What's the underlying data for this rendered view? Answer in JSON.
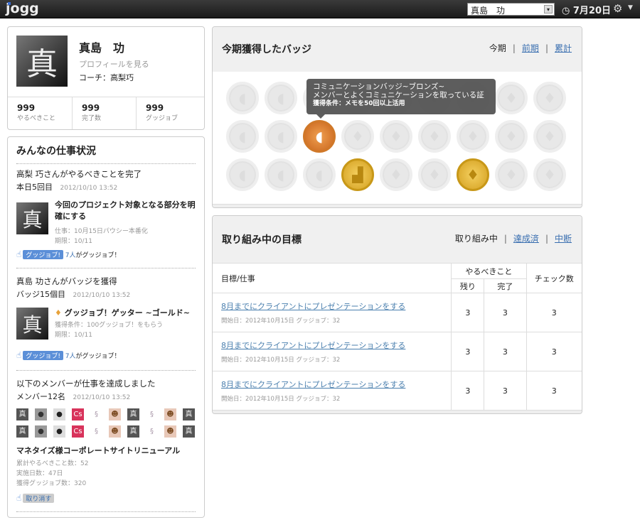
{
  "topbar": {
    "logo": "jogg",
    "user_select": "真島　功",
    "date": "7月20日"
  },
  "profile": {
    "avatar_char": "真",
    "name": "真島　功",
    "view_profile": "プロフィールを見る",
    "coach": "コーチ：高梨巧",
    "stats": [
      {
        "value": "999",
        "label": "やるべきこと"
      },
      {
        "value": "999",
        "label": "完了数"
      },
      {
        "value": "999",
        "label": "グッジョブ"
      }
    ]
  },
  "feed": {
    "title": "みんなの仕事状況",
    "item1": {
      "headline": "高梨 巧さんがやるべきことを完了",
      "sub": "本日5回目",
      "time": "2012/10/10  13:52",
      "task_title": "今回のプロジェクト対象となる部分を明確にする",
      "detail1": "仕事：10月15日パウシー本番化",
      "detail2": "期限：10/11",
      "gj_label": "グッジョブ!",
      "count": "7人",
      "count_suffix": "がグッジョブ！"
    },
    "item2": {
      "headline": "真島 功さんがバッジを獲得",
      "sub": "バッジ15個目",
      "time": "2012/10/10  13:52",
      "badge_title": "グッジョブ！ゲッター ~ゴールド~",
      "detail1": "獲得条件：100グッジョブ！をもらう",
      "detail2": "期限：10/11",
      "gj_label": "グッジョブ!",
      "count": "7人",
      "count_suffix": "がグッジョブ！"
    },
    "item3": {
      "headline": "以下のメンバーが仕事を達成しました",
      "sub": "メンバー12名",
      "time": "2012/10/10  13:52",
      "members": [
        "真",
        "photo",
        "photo2",
        "Cs",
        "bunny",
        "girl",
        "真",
        "bunny",
        "girl",
        "真",
        "真",
        "photo",
        "photo2",
        "Cs",
        "bunny",
        "girl",
        "真",
        "bunny",
        "girl",
        "真"
      ],
      "project": "マネタイズ様コーポレートサイトリニューアル",
      "detail1": "累計やるべきこと数：52",
      "detail2": "実施日数：47日",
      "detail3": "獲得グッジョブ数：320",
      "undo_label": "取り消す"
    }
  },
  "badges": {
    "title": "今期獲得したバッジ",
    "tabs": {
      "current": "今期",
      "prev": "前期",
      "total": "累計"
    },
    "grid": [
      [
        "pac",
        "pac",
        "pac",
        "dia",
        "dia",
        "dia",
        "dia",
        "dia",
        "dia"
      ],
      [
        "pac",
        "pac",
        "pac-bronze",
        "dia",
        "dia",
        "dia",
        "dia",
        "dia",
        "dia"
      ],
      [
        "pac",
        "pac",
        "pac",
        "chart-gold",
        "dia",
        "dia",
        "dia-gold",
        "dia",
        "dia"
      ]
    ],
    "tooltip": {
      "line1": "コミュニケーションバッジ~ブロンズ~",
      "line2": "メンバーとよくコミュニケーションを取っている証",
      "line3": "獲得条件：メモを50回以上活用"
    }
  },
  "goals": {
    "title": "取り組み中の目標",
    "tabs": {
      "current": "取り組み中",
      "done": "達成済",
      "paused": "中断"
    },
    "headers": {
      "goal": "目標/仕事",
      "todo": "やるべきこと",
      "remain": "残り",
      "done": "完了",
      "checks": "チェック数"
    },
    "rows": [
      {
        "title": "8月までにクライアントにプレゼンテーションをする",
        "meta": "開始日：2012年10月15日 グッジョブ：32",
        "remain": "3",
        "done": "3",
        "checks": "3"
      },
      {
        "title": "8月までにクライアントにプレゼンテーションをする",
        "meta": "開始日：2012年10月15日 グッジョブ：32",
        "remain": "3",
        "done": "3",
        "checks": "3"
      },
      {
        "title": "8月までにクライアントにプレゼンテーションをする",
        "meta": "開始日：2012年10月15日 グッジョブ：32",
        "remain": "3",
        "done": "3",
        "checks": "3"
      }
    ]
  }
}
